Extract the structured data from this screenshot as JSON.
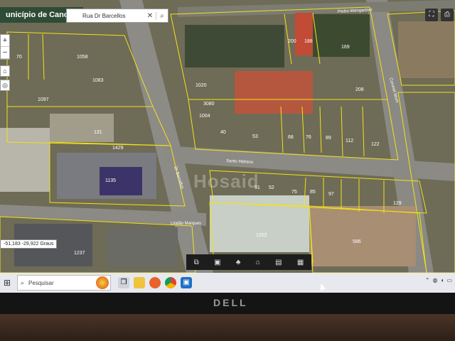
{
  "app": {
    "title": "unicípio de Canoas"
  },
  "search": {
    "value": "Rua Dr Barcellos",
    "clear_icon": "close-icon",
    "search_icon": "search-icon"
  },
  "map_controls": {
    "zoom_in": "+",
    "zoom_out": "−",
    "right_buttons": [
      "fullscreen-icon",
      "print-icon"
    ]
  },
  "coordinates": {
    "text": "-51,183 -29,922 Graus"
  },
  "streets": [
    {
      "name": "Pedro Wengartner"
    },
    {
      "name": "Dr Barcellos"
    },
    {
      "name": "Santo Hidrano"
    },
    {
      "name": "Lindão Marques"
    },
    {
      "name": "Coronel Mum"
    }
  ],
  "lots": [
    {
      "label": "70"
    },
    {
      "label": "1058"
    },
    {
      "label": "1083"
    },
    {
      "label": "1097"
    },
    {
      "label": "1020"
    },
    {
      "label": "1004"
    },
    {
      "label": "3080"
    },
    {
      "label": "131"
    },
    {
      "label": "1135"
    },
    {
      "label": "1429"
    },
    {
      "label": "1202"
    },
    {
      "label": "1237"
    },
    {
      "label": "200"
    },
    {
      "label": "188"
    },
    {
      "label": "169"
    },
    {
      "label": "208"
    },
    {
      "label": "52"
    },
    {
      "label": "61"
    },
    {
      "label": "75"
    },
    {
      "label": "85"
    },
    {
      "label": "97"
    },
    {
      "label": "112"
    },
    {
      "label": "122"
    },
    {
      "label": "129"
    },
    {
      "label": "89"
    },
    {
      "label": "76"
    },
    {
      "label": "68"
    },
    {
      "label": "40"
    },
    {
      "label": "53"
    },
    {
      "label": "586"
    }
  ],
  "watermark": "Hosaid",
  "map_toolbar": {
    "tools": [
      "layers-icon",
      "transit-icon",
      "nature-icon",
      "building-icon",
      "document-icon",
      "grid-icon"
    ]
  },
  "taskbar": {
    "search_placeholder": "Pesquisar",
    "apps": [
      "task-view-icon",
      "file-explorer-icon",
      "firefox-icon",
      "chrome-icon",
      "outlook-icon"
    ]
  },
  "monitor": {
    "brand": "DELL"
  },
  "colors": {
    "lot_outline": "#f2e21a",
    "taskbar": "#e7e9ef",
    "title_bar": "#2e4b35"
  }
}
